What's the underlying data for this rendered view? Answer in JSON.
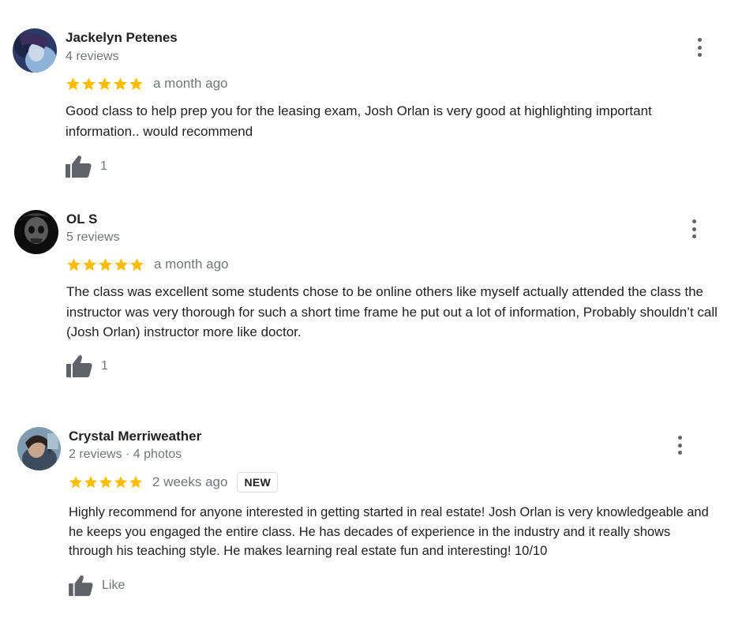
{
  "colors": {
    "star": "#fbbc04",
    "icon": "#5f6368",
    "secondary_text": "#70757a"
  },
  "reviews": [
    {
      "name": "Jackelyn Petenes",
      "meta": "4 reviews",
      "rating": 5,
      "date": "a month ago",
      "text": "Good class to help prep you for the leasing exam, Josh Orlan is very good at highlighting important information.. would recommend",
      "like_label": "1"
    },
    {
      "name": "OL S",
      "meta": "5 reviews",
      "rating": 5,
      "date": "a month ago",
      "text": "The class was excellent some students chose to be online others like myself actually attended the class the instructor was very thorough for such a short time frame he put out a lot of information, Probably shouldn’t call (Josh Orlan) instructor more like doctor.",
      "like_label": "1"
    },
    {
      "name": "Crystal Merriweather",
      "meta": "2 reviews · 4 photos",
      "rating": 5,
      "date": "2 weeks ago",
      "badge": "NEW",
      "text": "Highly recommend for anyone interested in getting started in real estate! Josh Orlan is very knowledgeable and he keeps you engaged the entire class. He has decades of experience in the industry and it really shows through his teaching style. He makes learning real estate fun and interesting! 10/10",
      "like_label": "Like"
    }
  ]
}
